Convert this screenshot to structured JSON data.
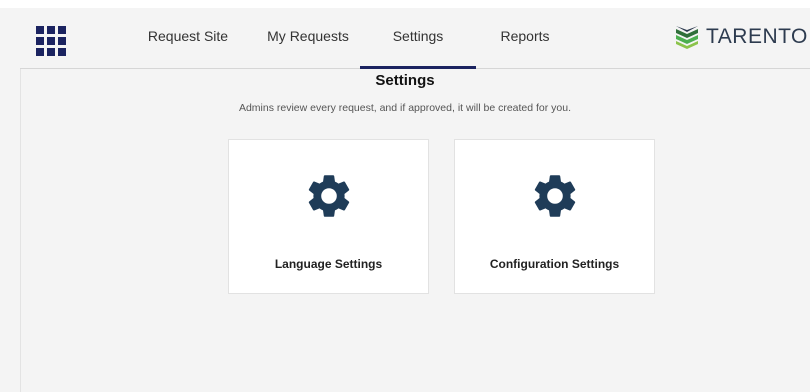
{
  "header": {
    "nav": [
      {
        "label": "Request Site"
      },
      {
        "label": "My Requests"
      },
      {
        "label": "Settings"
      },
      {
        "label": "Reports"
      }
    ],
    "active_tab": "Settings",
    "logo_text": "TARENTO"
  },
  "main": {
    "title": "Settings",
    "subtitle": "Admins review every request, and if approved, it will be created for you.",
    "cards": [
      {
        "label": "Language Settings",
        "icon": "gear-icon"
      },
      {
        "label": "Configuration Settings",
        "icon": "gear-icon"
      }
    ]
  },
  "colors": {
    "brand_navy": "#1b2360",
    "gear": "#1f3c58",
    "background": "#f4f4f4",
    "card": "#ffffff",
    "logo_green": "#4caf50"
  }
}
